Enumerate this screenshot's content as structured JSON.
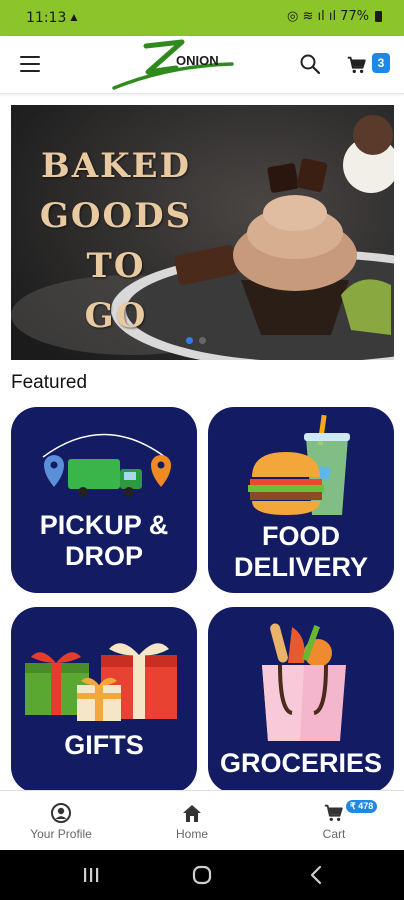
{
  "status": {
    "time": "11:13",
    "battery": "77%"
  },
  "header": {
    "logo_text": "ONION",
    "cart_count": "3"
  },
  "banner": {
    "lines": [
      "BAKED",
      "GOODS",
      "TO",
      "GO"
    ],
    "slide_index": 1,
    "slide_count": 2
  },
  "featured": {
    "title": "Featured",
    "cards": [
      {
        "line1": "PICKUP &",
        "line2": "DROP",
        "icon": "delivery-truck-icon"
      },
      {
        "line1": "FOOD",
        "line2": "DELIVERY",
        "icon": "burger-drink-icon"
      },
      {
        "line1": "GIFTS",
        "icon": "gift-boxes-icon"
      },
      {
        "line1": "GROCERIES",
        "icon": "grocery-bag-icon"
      }
    ]
  },
  "bottom_nav": {
    "profile": "Your Profile",
    "home": "Home",
    "cart": "Cart",
    "cart_badge": "₹ 478"
  },
  "colors": {
    "brand_green": "#8bc52a",
    "card_navy": "#131c63",
    "accent_blue": "#1e88e5"
  }
}
